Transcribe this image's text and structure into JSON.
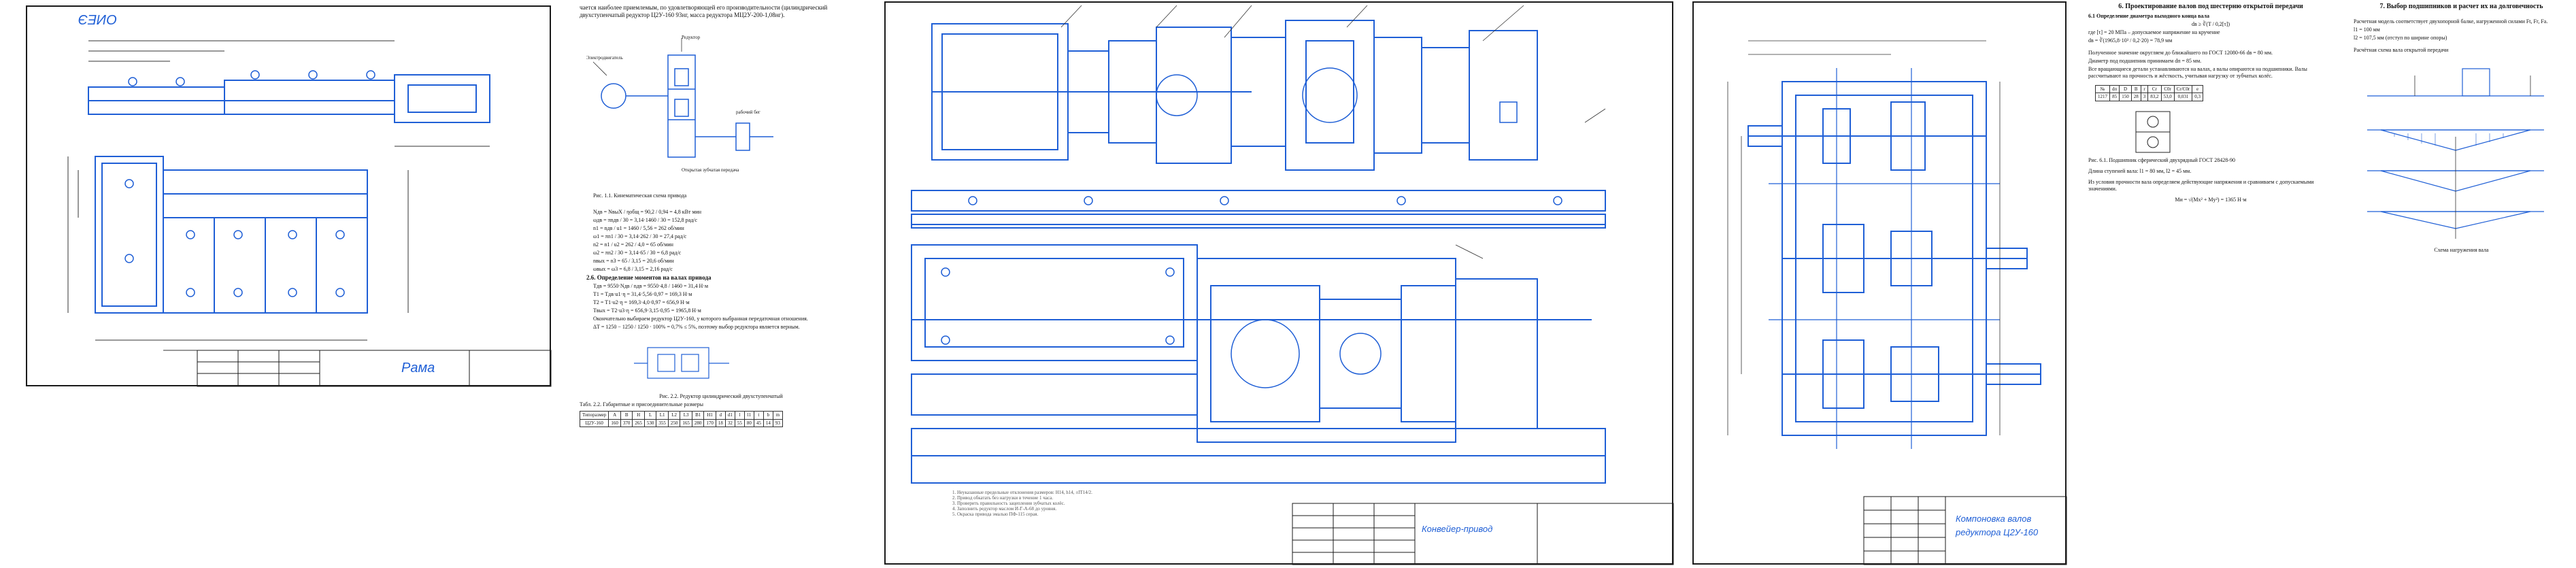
{
  "sheets": {
    "frame_drawing": {
      "corner_label": "ОИЕЭ",
      "stamp_label": "Рама"
    },
    "kinematics": {
      "intro": "чается наиболее приемлемым, по удовлетворяющей его производительности (цилиндрический двухступенчатый редуктор Ц2У-160 93нг, масса редуктора МЦ2У-200-1,08нг).",
      "fig1_caption": "Рис. 1.1. Кинематическая схема привода",
      "labels": {
        "motor": "Электродвигатель",
        "gearbox": "Редуктор",
        "transmission": "Открытая зубчатая передача",
        "drum": "рабочий бег"
      },
      "calc_lines": [
        "Nдв = NвыХ / ηобщ = 90,2 / 0,94 = 4,8 кВт мин",
        "ωдв = πnдв / 30 = 3,14·1460 / 30 = 152,8 рад/с",
        "n1 = nдв / u1 = 1460 / 5,56 = 262 об/мин",
        "ω1 = πn1 / 30 = 3,14·262 / 30 = 27,4 рад/с",
        "n2 = n1 / u2 = 262 / 4,0 = 65 об/мин",
        "ω2 = πn2 / 30 = 3,14·65 / 30 = 6,8 рад/с",
        "nвых = n3 = 65 / 3,15 = 20,6 об/мин",
        "ωвых = ω3 = 6,8 / 3,15 = 2,16 рад/с"
      ],
      "section2_heading": "2.6. Определение моментов на валах привода",
      "torque_lines": [
        "Tдв = 9550·Nдв / nдв = 9550·4,8 / 1460 = 31,4 Н·м",
        "T1 = Tдв·u1·η = 31,4·5,56·0,97 = 169,3 Н·м",
        "T2 = T1·u2·η = 169,3·4,0·0,97 = 656,9 Н·м",
        "Tвых = T2·u3·η = 656,9·3,15·0,95 = 1965,8 Н·м"
      ],
      "conclusion": "Окончательно выбираем редуктор Ц2У-160, у которого выбранная передаточная отношения.",
      "delta_line": "ΔT = 1250 − 1250 / 1250 · 100% = 0,7% ≤ 5%, поэтому выбор редуктора является верным.",
      "fig2_caption": "Рис. 2.2. Редуктор цилиндрический двухступенчатый",
      "table_caption": "Табл. 2.2. Габаритные и присоединительные размеры",
      "table_header": [
        "Типоразмер",
        "A",
        "B",
        "H",
        "L",
        "L1",
        "L2",
        "L3",
        "B1",
        "H1",
        "d",
        "d1",
        "l",
        "l1",
        "t",
        "b",
        "m"
      ],
      "table_row": [
        "Ц2У-160",
        "160",
        "370",
        "265",
        "530",
        "355",
        "250",
        "165",
        "280",
        "170",
        "18",
        "32",
        "55",
        "80",
        "45",
        "14",
        "93"
      ]
    },
    "assembly": {
      "stamp_label": "Конвейер-привод",
      "notes": [
        "1. Неуказанные предельные отклонения размеров: H14, h14, ±IT14/2.",
        "2. Привод обкатать без нагрузки в течение 1 часа.",
        "3. Проверить правильность зацепления зубчатых колёс.",
        "4. Заполнить редуктор маслом И-Г-А-68 до уровня.",
        "5. Окраска привода эмалью ПФ-115 серая."
      ]
    },
    "gearbox": {
      "stamp_line1": "Компоновка валов",
      "stamp_line2": "редуктора Ц2У-160"
    },
    "shaft_design": {
      "heading": "6. Проектирование валов под шестерню открытой передачи",
      "sub1": "6.1 Определение диаметра выходного конца вала",
      "formula1": "dв ≥ ∛(T / 0,2[τ])",
      "formula1_note": "где [τ] = 20 МПа – допускаемое напряжение на кручение",
      "formula1_calc": "dв = ∛(1965,8·10³ / 0,2·20) = 78,9 мм",
      "p1": "Полученное значение округляем до ближайшего по ГОСТ 12080-66 dв = 80 мм.",
      "p2": "Диаметр под подшипник принимаем dп = 85 мм.",
      "p3": "Все вращающиеся детали устанавливаются на валах, а валы опираются на подшипники. Валы рассчитывают на прочность и жёсткость, учитывая нагрузку от зубчатых колёс.",
      "table_header": [
        "№",
        "dп",
        "D",
        "B",
        "r",
        "Cr",
        "C0r",
        "Cr/C0r",
        "e"
      ],
      "table_row": [
        "1217",
        "85",
        "150",
        "28",
        "3",
        "83,2",
        "53,0",
        "0,031",
        "0,3"
      ],
      "fig_caption": "Рис. 6.1. Подшипник сферический двухрядный ГОСТ 28428-90",
      "p4": "Длина ступеней вала: l1 = 80 мм, l2 = 45 мм.",
      "p5": "Из условия прочности вала определяем действующие напряжения и сравниваем с допускаемыми значениями.",
      "formula2": "Mи = √(Mx² + My²) = 1365 Н·м"
    },
    "bearings": {
      "heading": "7. Выбор подшипников и расчет их на долговечность",
      "p1": "Расчетная модель соответствует двухопорной балке, нагруженной силами Ft, Fr, Fa.",
      "p2": "l1 = 100 мм",
      "p3": "l2 = 107,5 мм (отступ по ширине опоры)",
      "p4": "Расчётная схема вала открытой передачи",
      "diagram_label": "Схема нагружения вала"
    }
  }
}
